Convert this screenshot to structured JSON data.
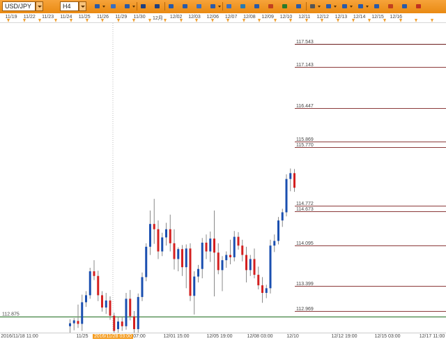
{
  "toolbar": {
    "symbol": "USD/JPY",
    "timeframe": "H4",
    "buttons": [
      {
        "name": "chart-type-button",
        "icon": "candlestick-icon",
        "dropdown": true
      },
      {
        "name": "crosshair-button",
        "icon": "crosshair-icon",
        "dropdown": false
      },
      {
        "name": "chart-style-button",
        "icon": "bar-style-icon",
        "dropdown": true
      },
      {
        "name": "text-tool-a-button",
        "icon": "text-label-icon",
        "dropdown": false
      },
      {
        "name": "text-tool-b-button",
        "icon": "text-label-icon",
        "dropdown": false
      },
      {
        "name": "zoom-in-button",
        "icon": "zoom-in-icon",
        "dropdown": false
      },
      {
        "name": "zoom-out-button",
        "icon": "zoom-out-icon",
        "dropdown": false
      },
      {
        "name": "document-button",
        "icon": "document-icon",
        "dropdown": false
      },
      {
        "name": "indicator-button",
        "icon": "indicator-icon",
        "dropdown": true
      },
      {
        "name": "comment-button",
        "icon": "comment-icon",
        "dropdown": false
      },
      {
        "name": "refresh-button",
        "icon": "refresh-icon",
        "dropdown": false
      },
      {
        "name": "select-button",
        "icon": "select-icon",
        "dropdown": false
      },
      {
        "name": "pencil-button",
        "icon": "pencil-icon",
        "dropdown": false
      },
      {
        "name": "image-button",
        "icon": "image-icon",
        "dropdown": false
      },
      {
        "name": "screenshot-button",
        "icon": "camera-icon",
        "dropdown": false
      },
      {
        "name": "tools-button",
        "icon": "wrench-icon",
        "dropdown": true
      },
      {
        "name": "trend-tool-button",
        "icon": "trendline-icon",
        "dropdown": true
      },
      {
        "name": "line-tool-button",
        "icon": "line-icon",
        "dropdown": true
      },
      {
        "name": "shape-tool-button",
        "icon": "ellipse-icon",
        "dropdown": true
      },
      {
        "name": "settings-button",
        "icon": "gear-icon",
        "dropdown": false
      },
      {
        "name": "eraser-button",
        "icon": "eraser-icon",
        "dropdown": false
      },
      {
        "name": "alert-button",
        "icon": "bell-icon",
        "dropdown": false
      },
      {
        "name": "close-chart-button",
        "icon": "close-icon",
        "dropdown": false
      }
    ]
  },
  "date_ruler": {
    "labels": [
      "11/19",
      "11/22",
      "11/23",
      "11/24",
      "11/25",
      "11/26",
      "11/29",
      "11/30",
      "12月",
      "12/02",
      "12/03",
      "12/06",
      "12/07",
      "12/08",
      "12/09",
      "12/10",
      "12/11",
      "12/12",
      "12/13",
      "12/14",
      "12/15",
      "12/16"
    ]
  },
  "colors": {
    "up": "#1a4fb0",
    "down": "#d42020",
    "wick": "#888888",
    "level_line": "#8b3a3a",
    "level_line_top": "#6b1a1a",
    "horizontal_green": "#1c6b1c",
    "accent": "#f49c20"
  },
  "chart_data": {
    "type": "candlestick",
    "symbol": "USD/JPY",
    "timeframe": "H4",
    "ylim": [
      112.6,
      117.9
    ],
    "price_levels": [
      117.543,
      117.143,
      116.447,
      115.869,
      115.77,
      114.772,
      114.673,
      114.095,
      113.399,
      112.969
    ],
    "price_level_labels": [
      "117.543",
      "117.143",
      "116.447",
      "115.869",
      "115.770",
      "114.772",
      "114.673",
      "114.095",
      "113.399",
      "112.969"
    ],
    "horizontal_line": {
      "value": 112.875,
      "label": "112.875"
    },
    "x_labels": [
      "2016/11/18 11:00",
      "11/25",
      "2016/11/28 03:00",
      "07:00",
      "12/01 15:00",
      "12/05 19:00",
      "12/08 03:00",
      "12/10",
      "12/12 19:00",
      "12/15 03:00",
      "12/17 11:00"
    ],
    "highlighted_x_label": "2016/11/28 03:00",
    "candles": [
      {
        "o": 112.71,
        "h": 112.83,
        "l": 112.6,
        "c": 112.76
      },
      {
        "o": 112.76,
        "h": 112.85,
        "l": 112.64,
        "c": 112.81
      },
      {
        "o": 112.8,
        "h": 113.08,
        "l": 112.68,
        "c": 112.75
      },
      {
        "o": 112.75,
        "h": 113.25,
        "l": 112.63,
        "c": 113.12
      },
      {
        "o": 113.12,
        "h": 113.31,
        "l": 113.04,
        "c": 113.24
      },
      {
        "o": 113.24,
        "h": 113.71,
        "l": 113.18,
        "c": 113.65
      },
      {
        "o": 113.65,
        "h": 113.84,
        "l": 113.5,
        "c": 113.57
      },
      {
        "o": 113.57,
        "h": 113.66,
        "l": 113.14,
        "c": 113.24
      },
      {
        "o": 113.24,
        "h": 113.31,
        "l": 112.96,
        "c": 113.03
      },
      {
        "o": 113.03,
        "h": 113.28,
        "l": 112.92,
        "c": 113.15
      },
      {
        "o": 113.15,
        "h": 113.22,
        "l": 112.82,
        "c": 112.89
      },
      {
        "o": 112.89,
        "h": 112.94,
        "l": 112.59,
        "c": 112.63
      },
      {
        "o": 112.66,
        "h": 112.86,
        "l": 112.57,
        "c": 112.79
      },
      {
        "o": 112.79,
        "h": 112.88,
        "l": 112.63,
        "c": 112.71
      },
      {
        "o": 112.71,
        "h": 113.28,
        "l": 112.65,
        "c": 113.18
      },
      {
        "o": 113.18,
        "h": 113.33,
        "l": 112.81,
        "c": 112.88
      },
      {
        "o": 112.88,
        "h": 112.97,
        "l": 112.6,
        "c": 112.66
      },
      {
        "o": 112.66,
        "h": 113.27,
        "l": 112.58,
        "c": 113.21
      },
      {
        "o": 113.21,
        "h": 113.63,
        "l": 113.14,
        "c": 113.55
      },
      {
        "o": 113.55,
        "h": 114.13,
        "l": 113.48,
        "c": 114.07
      },
      {
        "o": 114.07,
        "h": 114.69,
        "l": 113.93,
        "c": 114.46
      },
      {
        "o": 114.46,
        "h": 114.89,
        "l": 114.12,
        "c": 114.37
      },
      {
        "o": 114.37,
        "h": 114.52,
        "l": 113.86,
        "c": 113.99
      },
      {
        "o": 113.99,
        "h": 114.31,
        "l": 113.91,
        "c": 114.23
      },
      {
        "o": 114.23,
        "h": 114.48,
        "l": 114.09,
        "c": 114.37
      },
      {
        "o": 114.37,
        "h": 114.62,
        "l": 113.99,
        "c": 114.13
      },
      {
        "o": 114.13,
        "h": 114.37,
        "l": 113.68,
        "c": 113.86
      },
      {
        "o": 113.86,
        "h": 114.06,
        "l": 113.65,
        "c": 114.03
      },
      {
        "o": 114.03,
        "h": 114.1,
        "l": 113.57,
        "c": 113.72
      },
      {
        "o": 113.72,
        "h": 114.11,
        "l": 113.36,
        "c": 114.04
      },
      {
        "o": 114.04,
        "h": 114.13,
        "l": 113.14,
        "c": 113.23
      },
      {
        "o": 113.23,
        "h": 113.65,
        "l": 112.91,
        "c": 113.56
      },
      {
        "o": 113.56,
        "h": 113.76,
        "l": 113.46,
        "c": 113.69
      },
      {
        "o": 113.69,
        "h": 114.22,
        "l": 113.53,
        "c": 114.14
      },
      {
        "o": 114.14,
        "h": 114.28,
        "l": 113.86,
        "c": 113.99
      },
      {
        "o": 113.99,
        "h": 114.33,
        "l": 113.81,
        "c": 114.21
      },
      {
        "o": 114.21,
        "h": 114.69,
        "l": 113.22,
        "c": 113.97
      },
      {
        "o": 113.97,
        "h": 114.13,
        "l": 113.6,
        "c": 113.67
      },
      {
        "o": 113.67,
        "h": 113.91,
        "l": 113.31,
        "c": 113.84
      },
      {
        "o": 113.84,
        "h": 113.99,
        "l": 113.71,
        "c": 113.93
      },
      {
        "o": 113.93,
        "h": 114.19,
        "l": 113.77,
        "c": 113.89
      },
      {
        "o": 113.89,
        "h": 114.34,
        "l": 113.82,
        "c": 114.24
      },
      {
        "o": 114.24,
        "h": 114.32,
        "l": 114.02,
        "c": 114.09
      },
      {
        "o": 114.09,
        "h": 114.19,
        "l": 113.82,
        "c": 113.93
      },
      {
        "o": 113.93,
        "h": 114.07,
        "l": 113.46,
        "c": 113.67
      },
      {
        "o": 113.67,
        "h": 113.93,
        "l": 113.57,
        "c": 113.86
      },
      {
        "o": 113.86,
        "h": 114.04,
        "l": 113.53,
        "c": 113.59
      },
      {
        "o": 113.59,
        "h": 113.73,
        "l": 113.34,
        "c": 113.41
      },
      {
        "o": 113.41,
        "h": 113.55,
        "l": 113.11,
        "c": 113.28
      },
      {
        "o": 113.28,
        "h": 113.42,
        "l": 113.19,
        "c": 113.36
      },
      {
        "o": 113.36,
        "h": 114.19,
        "l": 113.27,
        "c": 114.09
      },
      {
        "o": 114.09,
        "h": 114.28,
        "l": 113.98,
        "c": 114.17
      },
      {
        "o": 114.17,
        "h": 114.58,
        "l": 114.11,
        "c": 114.52
      },
      {
        "o": 114.52,
        "h": 114.72,
        "l": 114.41,
        "c": 114.66
      },
      {
        "o": 114.66,
        "h": 115.31,
        "l": 114.59,
        "c": 115.23
      },
      {
        "o": 115.23,
        "h": 115.41,
        "l": 115.02,
        "c": 115.33
      },
      {
        "o": 115.33,
        "h": 115.4,
        "l": 115.01,
        "c": 115.08
      }
    ]
  }
}
